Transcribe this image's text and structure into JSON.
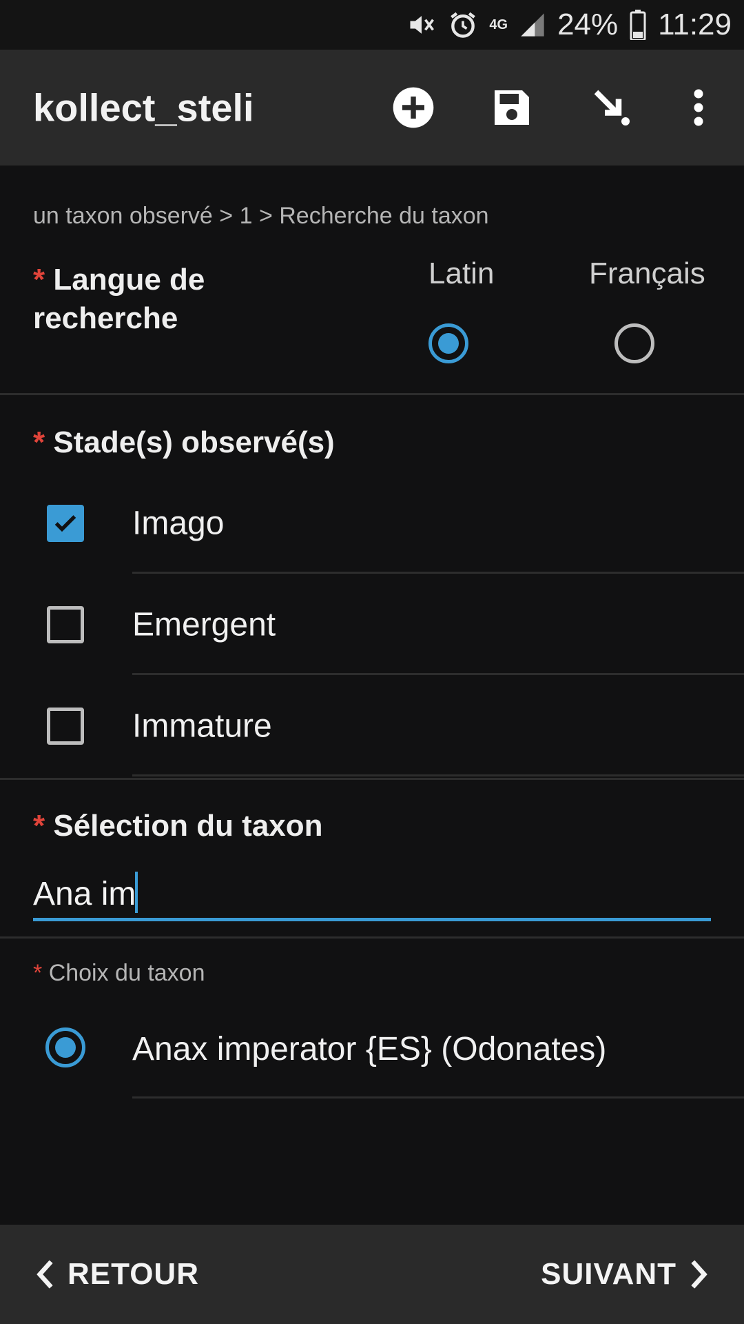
{
  "status_bar": {
    "network": "4G",
    "battery": "24%",
    "time": "11:29",
    "icons": [
      "mute-vibrate-icon",
      "alarm-icon",
      "network-4g-icon",
      "signal-icon",
      "battery-icon"
    ]
  },
  "app_bar": {
    "title": "kollect_steli",
    "actions": [
      "add-circle-icon",
      "save-icon",
      "download-arrow-icon",
      "more-vert-icon"
    ]
  },
  "breadcrumb": "un taxon observé > 1 > Recherche du taxon",
  "required_marker": "*",
  "langue": {
    "label": "Langue de recherche",
    "options": [
      {
        "label": "Latin",
        "selected": true
      },
      {
        "label": "Français",
        "selected": false
      }
    ]
  },
  "stades": {
    "label": "Stade(s) observé(s)",
    "items": [
      {
        "label": "Imago",
        "checked": true
      },
      {
        "label": "Emergent",
        "checked": false
      },
      {
        "label": "Immature",
        "checked": false
      }
    ]
  },
  "selection": {
    "label": "Sélection du taxon",
    "value": "Ana im"
  },
  "choix": {
    "label": "Choix du taxon",
    "options": [
      {
        "label": "Anax imperator {ES} (Odonates)",
        "selected": true
      }
    ]
  },
  "bottom_bar": {
    "back_label": "RETOUR",
    "next_label": "SUIVANT"
  },
  "colors": {
    "accent": "#3a9bd5",
    "required": "#e0443a",
    "bar_background": "#2a2a2a",
    "page_background": "#111112"
  }
}
